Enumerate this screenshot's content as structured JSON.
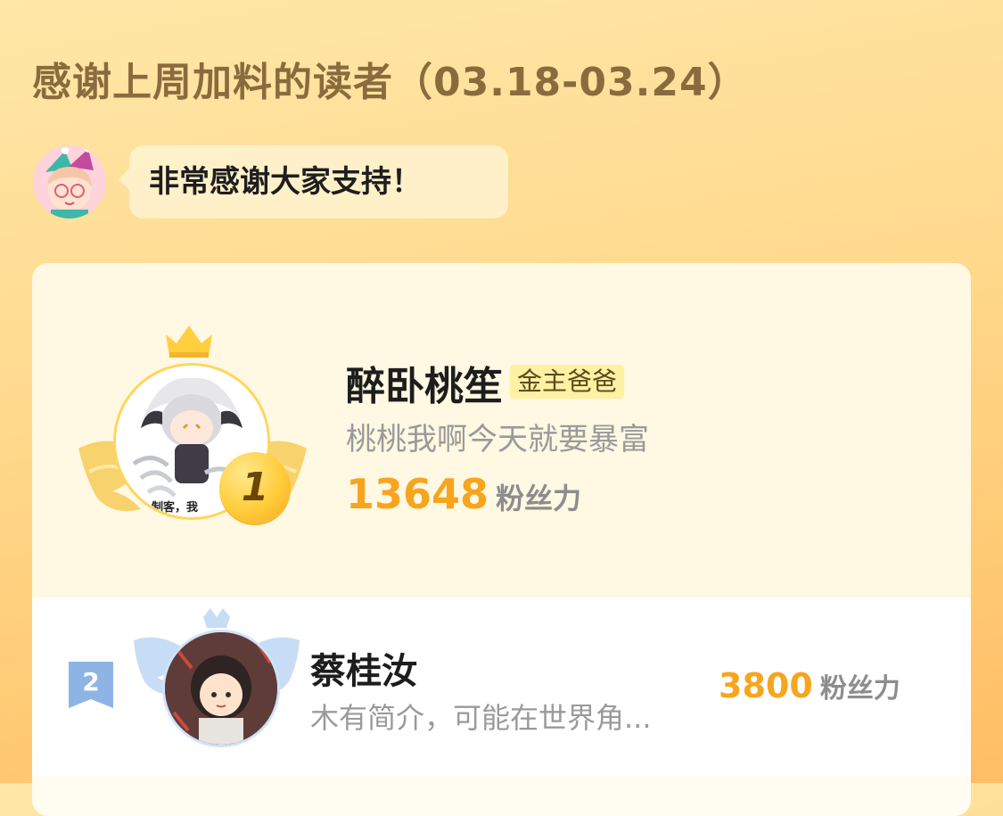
{
  "header": {
    "title": "感谢上周加料的读者（03.18-03.24）"
  },
  "host": {
    "message": "非常感谢大家支持！"
  },
  "ranking": {
    "entries": [
      {
        "rank": "1",
        "name": "醉卧桃笙",
        "badge": "金主爸爸",
        "bio": "桃桃我啊今天就要暴富",
        "score": "13648",
        "unit": "粉丝力",
        "avatar_caption": "制客，我"
      },
      {
        "rank": "2",
        "name": "蔡桂汝",
        "bio": "木有简介，可能在世界角...",
        "score": "3800",
        "unit": "粉丝力"
      }
    ]
  },
  "colors": {
    "accent": "#f7a51e",
    "title": "#8a6b3e",
    "gold_badge_bg": "#fff0a3",
    "silver_rank": "#8eb4e6"
  },
  "icons": {
    "crown": "crown-icon",
    "wings": "wings-icon",
    "medal": "rank-medal-icon"
  }
}
